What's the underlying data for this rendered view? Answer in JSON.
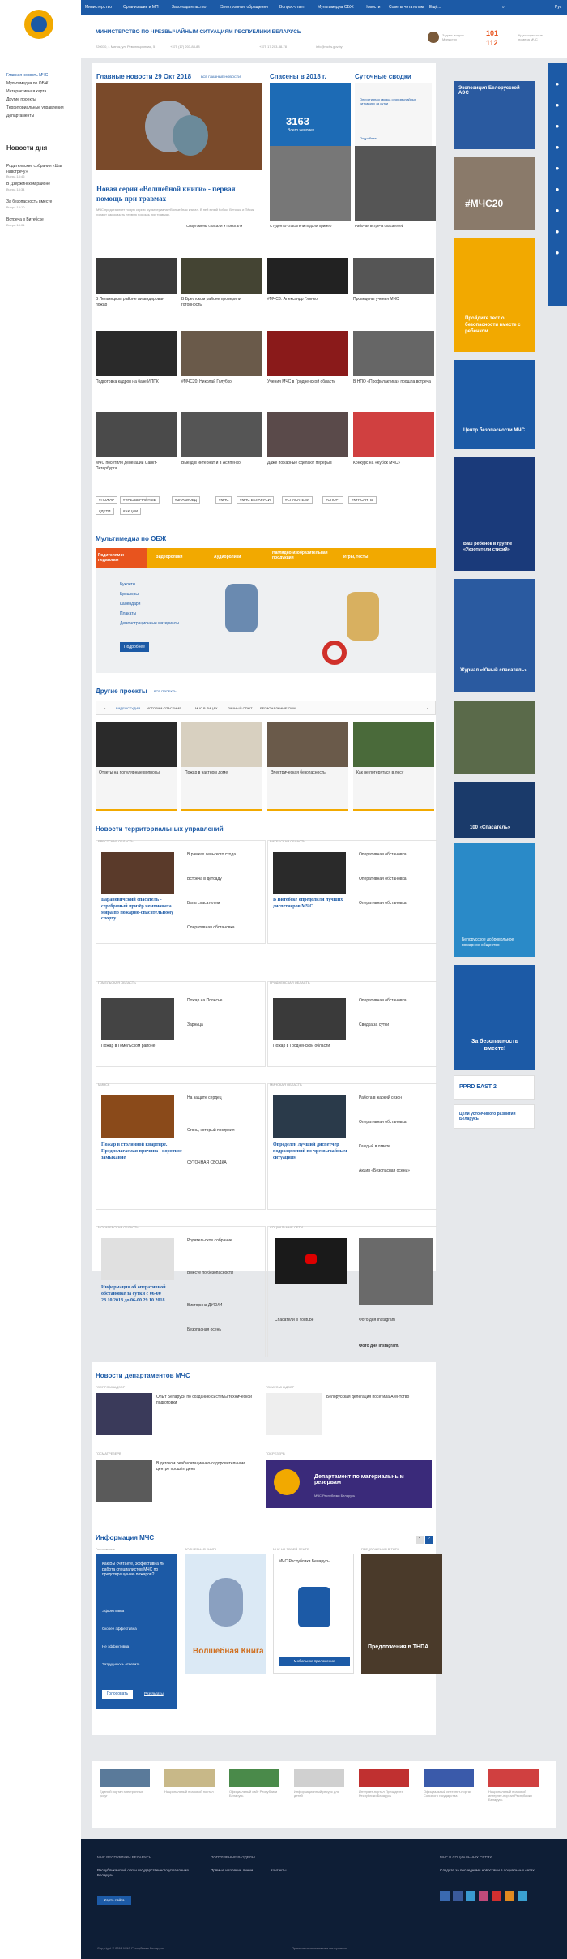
{
  "topnav": {
    "items": [
      "Министерство",
      "Организации и МП",
      "Законодательство",
      "Электронные обращения",
      "Вопрос-ответ",
      "Мультимедиа ОБЖ",
      "Новости",
      "Советы читателям",
      "Ещё..."
    ],
    "lang": "Рус"
  },
  "header": {
    "title": "МИНИСТЕРСТВО ПО ЧРЕЗВЫЧАЙНЫМ СИТУАЦИЯМ РЕСПУБЛИКИ БЕЛАРУСЬ",
    "address": "220030, г. Минск, ул. Революционная, 5",
    "phone1": "+375 (17) 203-88-88",
    "phone2": "+375 17 203-88-78",
    "email": "info@mchs.gov.by",
    "hotline_text": "Задать вопрос Министру",
    "num1": "101",
    "num2": "112",
    "num_text": "Круглосуточные номера МЧС"
  },
  "sidebar": {
    "items": [
      "Главная новость МЧС",
      "Мультимедиа по ОБЖ",
      "Интерактивная карта",
      "Другие проекты",
      "Территориальные управления",
      "Департаменты"
    ],
    "day_title": "Новости дня",
    "day": [
      {
        "t": "Родительские собрания «Шаг навстречу»",
        "d": "Вчера 18:46"
      },
      {
        "t": "В Дзержинском районе",
        "d": "Вчера 18:34"
      },
      {
        "t": "За безопасность вместе",
        "d": "Вчера 18:10"
      },
      {
        "t": "Встреча в Витебске",
        "d": "Вчера 18:01"
      }
    ]
  },
  "main_news": {
    "title": "Главные новости 29 Окт 2018",
    "all": "ВСЕ ГЛАВНЫЕ НОВОСТИ",
    "headline": "Новая серия «Волшебной книги» - первая помощь при травмах",
    "lead": "МЧС представляет новую серию мультсериала «Волшебная книга». В ней юный Кобос, Веточка и Пёсик узнают как оказать первую помощь при травмах."
  },
  "rescued": {
    "title": "Спасены в 2018 г.",
    "count": "3163",
    "label": "Всего человек"
  },
  "daily": {
    "title": "Суточные сводки",
    "text": "Оперативная сводка о чрезвычайных ситуациях за сутки",
    "link": "Подробнее"
  },
  "grid": [
    {
      "c": "Спортсмены спасали и помогали",
      "d": "29.10.2018"
    },
    {
      "c": "Студенты-спасатели подали пример",
      "d": "29.10.2018"
    },
    {
      "c": "Рабочая встреча спасателей",
      "d": "29.10.2018"
    },
    {
      "c": "В Лельчицком районе ликвидирован пожар",
      "d": "29.10.2018"
    },
    {
      "c": "В Брестском районе проверили готовность",
      "d": "29.10.2018"
    },
    {
      "c": "#МЧСЗ: Александр Глинко",
      "d": "29.10.2018"
    },
    {
      "c": "Проведены учения МЧС",
      "d": "29.10.2018"
    },
    {
      "c": "Подготовка кадров на базе ИППК",
      "d": "29.10.2018"
    },
    {
      "c": "#МЧС20: Николай Голубко",
      "d": "29.10.2018"
    },
    {
      "c": "Учения МЧС в Гродненской области",
      "d": "29.10.2018"
    },
    {
      "c": "В НПО «Профилактика» прошла встреча",
      "d": "29.10.2018"
    },
    {
      "c": "МЧС посетили делегации Санкт-Петербурга",
      "d": "29.10.2018"
    },
    {
      "c": "Выезд в интернат и в Асипенко",
      "d": "29.10.2018"
    },
    {
      "c": "Даже пожарные сделают перерыв",
      "d": "29.10.2018"
    },
    {
      "c": "Конкурс на «Кубок МЧС»",
      "d": "29.10.2018"
    }
  ],
  "tags": [
    "#ПОЖАР",
    "#ЧРЕЗВЫЧАЙНЫЕ",
    "#ЗНАКИОВД",
    "#МЧС",
    "#МЧС БЕЛАРУСИ",
    "#СПАСАТЕЛИ",
    "#СПОРТ",
    "#КУРСАНТЫ",
    "#ДЕТИ",
    "#АКЦИИ"
  ],
  "obzh": {
    "title": "Мультимедиа по ОБЖ",
    "tabs": [
      "Родителям и педагогам",
      "Видеоролики",
      "Аудиоролики",
      "Наглядно-изобразительная продукция",
      "Игры, тесты"
    ],
    "list": [
      "Буклеты",
      "Брошюры",
      "Календари",
      "Плакаты",
      "Демонстрационные материалы"
    ],
    "btn": "Подробнее"
  },
  "projects": {
    "title": "Другие проекты",
    "all": "ВСЕ ПРОЕКТЫ",
    "tabs": [
      "ВИДЕОСТУДИЯ",
      "ИСТОРИИ СПАСЕНИЯ",
      "МЧС В ЛИЦАХ",
      "ЛИЧНЫЙ ОПЫТ",
      "РЕГИОНАЛЬНЫЕ СМИ"
    ],
    "items": [
      {
        "c": "Ответы на популярные вопросы"
      },
      {
        "c": "Пожар в частном доме"
      },
      {
        "c": "Электрическая безопасность"
      },
      {
        "c": "Как не потеряться в лесу"
      }
    ]
  },
  "terr": {
    "title": "Новости территориальных управлений",
    "regions": [
      {
        "name": "БРЕСТСКАЯ ОБЛАСТЬ",
        "h": "Барановичский спасатель - серебряный призёр чемпионата мира по пожарно-спасательному спорту",
        "l": [
          "В рамках сельского схода",
          "Встреча в детсаду",
          "Быть спасателем",
          "Оперативная обстановка"
        ]
      },
      {
        "name": "ВИТЕБСКАЯ ОБЛАСТЬ",
        "h": "В Витебске определили лучших диспетчеров МЧС",
        "l": [
          "Оперативная обстановка",
          "Оперативная обстановка",
          "Оперативная обстановка"
        ]
      },
      {
        "name": "ГОМЕЛЬСКАЯ ОБЛАСТЬ",
        "h": "Пожар в Гомельском районе",
        "l": [
          "Пожар на Полесье",
          "Зарница"
        ]
      },
      {
        "name": "ГРОДНЕНСКАЯ ОБЛАСТЬ",
        "h": "Пожар в Гродненской области",
        "l": [
          "Оперативная обстановка",
          "Сводка за сутки"
        ]
      },
      {
        "name": "МИНСК",
        "h": "Пожар в столичной квартире. Предполагаемая причина - короткое замыкание",
        "l": [
          "На защите сердец",
          "Огонь, который построил",
          "СУТОЧНАЯ СВОДКА"
        ]
      },
      {
        "name": "МИНСКАЯ ОБЛАСТЬ",
        "h": "Определен лучший диспетчер подразделений по чрезвычайным ситуациям",
        "l": [
          "Работа в жаркий сезон",
          "Оперативная обстановка",
          "Каждый в ответе",
          "Акция «Безопасная осень»"
        ]
      },
      {
        "name": "МОГИЛЕВСКАЯ ОБЛАСТЬ",
        "h": "Информация об оперативной обстановке за сутки с 06-00 28.10.2018 до 06-00 29.10.2018",
        "l": [
          "Родительское собрание",
          "Вместе по безопасности",
          "Викторина ДУСИИ",
          "Безопасная осень"
        ]
      },
      {
        "name": "СОЦИАЛЬНЫЕ СЕТИ",
        "h": "Фото дня Instagram.",
        "l": [
          "Спасатели в Youtube",
          "Фото дня Instagram"
        ]
      }
    ]
  },
  "depts": {
    "title": "Новости департаментов МЧС",
    "items": [
      {
        "name": "ГОСПРОМНАДЗОР",
        "t": "Опыт Беларуси по созданию системы технической подготовки"
      },
      {
        "name": "ГОСАТОМНАДЗОР",
        "t": "Белорусская делегация посетила Агентство"
      },
      {
        "name": "ГОСМАТРЕЗЕРВ",
        "t": "В детском реабилитационно-оздоровительном центре прошёл день"
      },
      {
        "name": "ГОСРЕЗЕРВ",
        "banner": "Департамент по материальным резервам",
        "sub": "МЧС Республики Беларусь"
      }
    ]
  },
  "info": {
    "title": "Информация МЧС",
    "poll_title": "Голосование",
    "poll_q": "Как Вы считаете, эффективна ли работа специалистов МЧС по предотвращению пожаров?",
    "opts": [
      "Эффективна",
      "Скорее эффективна",
      "Не эффективна",
      "Затрудняюсь ответить"
    ],
    "vote": "Голосовать",
    "results": "Результаты",
    "c1": "ВОЛШЕБНАЯ КНИГА",
    "c2": "МЧС НА ТВОЕЙ ЛЕНТЕ",
    "c3": "ПРЕДЛОЖЕНИЯ В ТНПА",
    "app": "МЧС Республики Беларусь",
    "app_btn": "Мобильное приложение",
    "tnpa": "Предложения в ТНПА",
    "book": "Волшебная Книга"
  },
  "partners": [
    {
      "t": "Единый портал электронных услуг"
    },
    {
      "t": "Национальный правовой портал"
    },
    {
      "t": "Официальный сайт Республики Беларусь"
    },
    {
      "t": "Информационный ресурс для детей"
    },
    {
      "t": "Интернет-портал Президента Республики Беларусь"
    },
    {
      "t": "Официальный интернет-портал Союзного государства"
    },
    {
      "t": "Национальный правовой интернет-портал Республики Беларусь"
    }
  ],
  "banners": [
    "Экспозиция Белорусской АЭС",
    "#МЧС20",
    "Пройдите тест о безопасности вместе с ребенком",
    "Центр безопасности МЧС",
    "Ваш ребенок в группе «Укротители стихий»",
    "Журнал «Юный спасатель»",
    "100 «Спасатель»",
    "Белорусское добровольное пожарное общество",
    "За безопасность вместе!",
    "PPRD EAST 2",
    "Цели устойчивого развития Беларусь"
  ],
  "footer": {
    "c1": "МЧС РЕСПУБЛИКИ БЕЛАРУСЬ",
    "c1t": "Республиканский орган государственного управления Беларусь",
    "c2": "ПОПУЛЯРНЫЕ РАЗДЕЛЫ",
    "c2l": [
      "Прямые и горячие линии",
      "Контакты"
    ],
    "c3": "МЧС В СОЦИАЛЬНЫХ СЕТЯХ",
    "c3t": "Следите за последними новостями в социальных сетях",
    "map": "Карта сайта",
    "copy": "Copyright © 2018 МЧС Республики Беларусь",
    "rules": "Правила использования материалов"
  }
}
